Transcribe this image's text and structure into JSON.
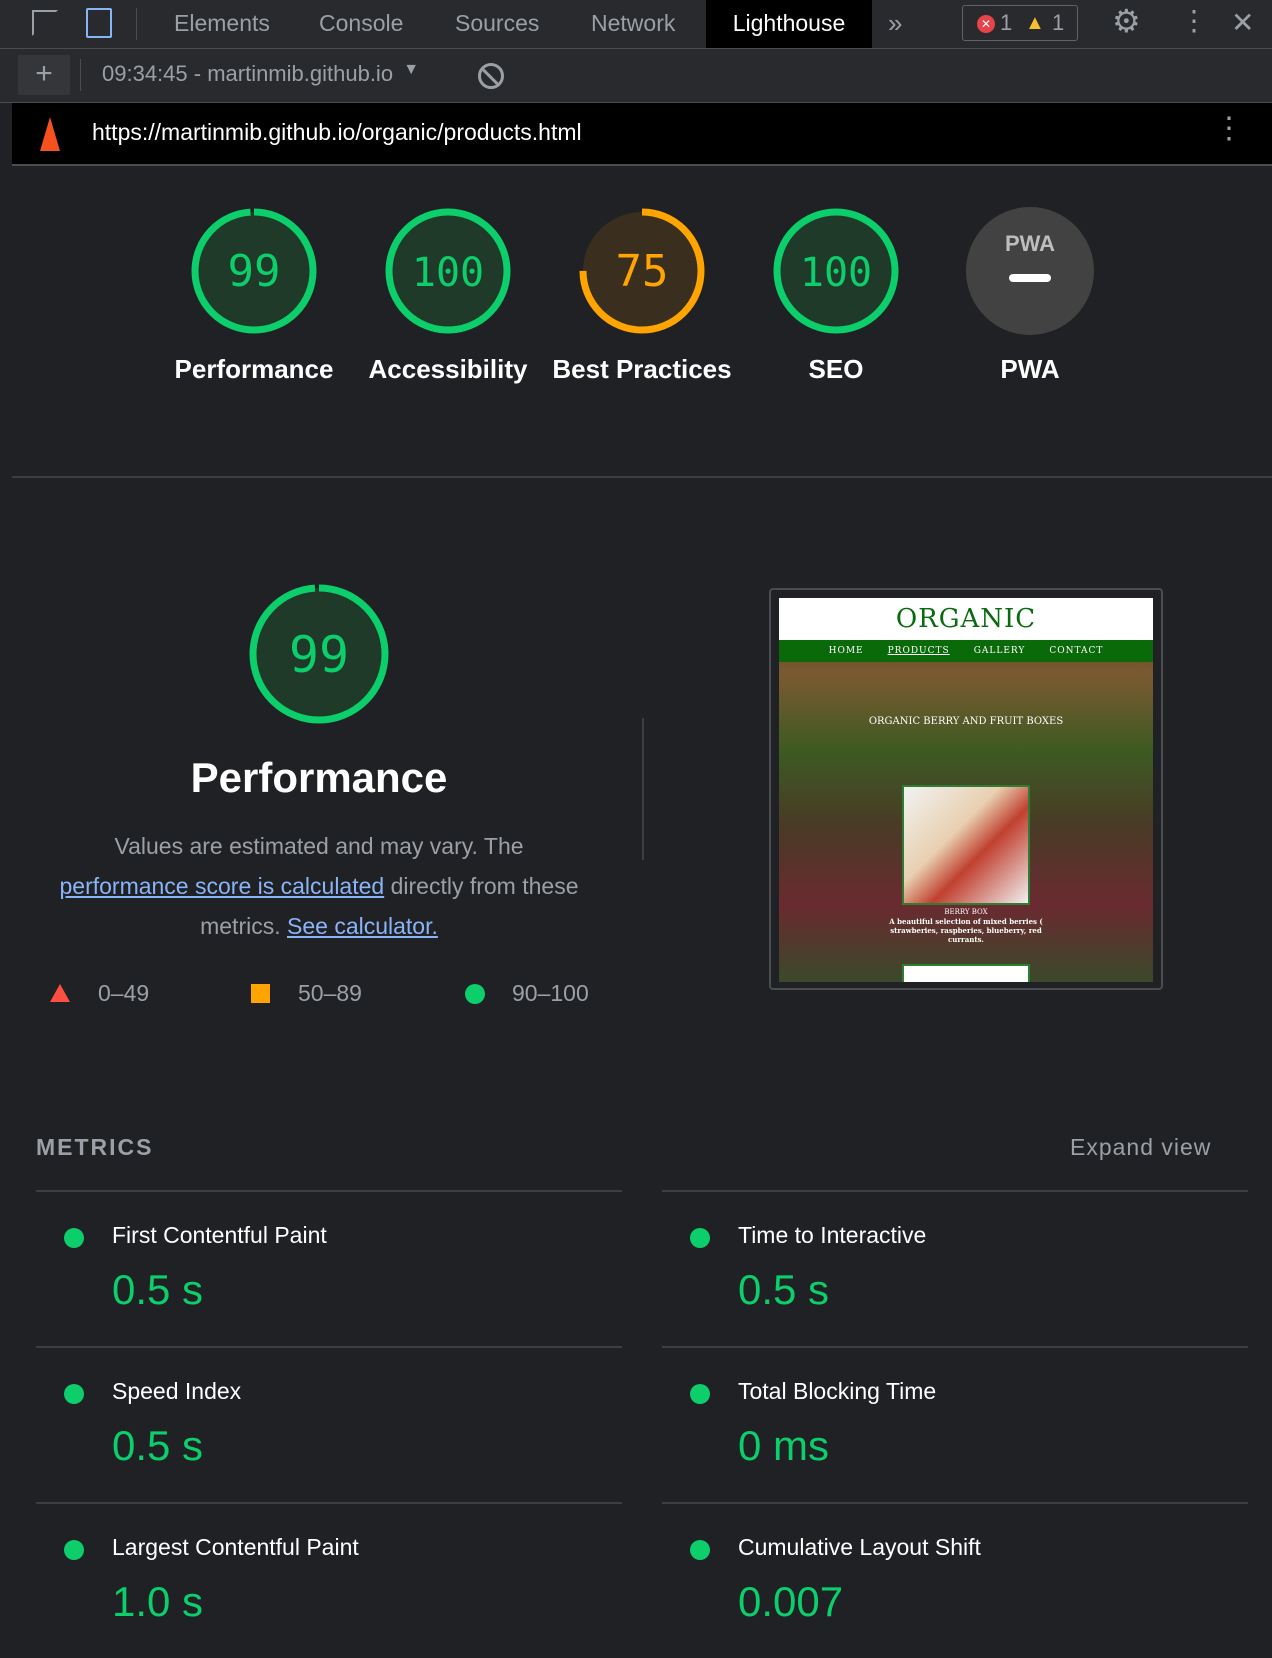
{
  "devtools": {
    "tabs": [
      "Elements",
      "Console",
      "Sources",
      "Network",
      "Lighthouse"
    ],
    "active_tab": "Lighthouse",
    "error_count": "1",
    "warning_count": "1"
  },
  "toolbar": {
    "report_select": "09:34:45 - martinmib.github.io"
  },
  "report": {
    "url": "https://martinmib.github.io/organic/products.html"
  },
  "gauges": [
    {
      "label": "Performance",
      "score": "99",
      "status": "pass"
    },
    {
      "label": "Accessibility",
      "score": "100",
      "status": "pass"
    },
    {
      "label": "Best Practices",
      "score": "75",
      "status": "average"
    },
    {
      "label": "SEO",
      "score": "100",
      "status": "pass"
    },
    {
      "label": "PWA",
      "score": "PWA",
      "status": "na"
    }
  ],
  "colors": {
    "pass": "#0cce6b",
    "average": "#ffa400",
    "fail": "#ff4e42"
  },
  "performance": {
    "score": "99",
    "title": "Performance",
    "desc_1": "Values are estimated and may vary. The",
    "link_1": "performance score is calculated",
    "desc_2": "directly from these",
    "desc_3": "metrics.",
    "link_2": "See calculator.",
    "legend": [
      {
        "range": "0–49",
        "icon": "triangle"
      },
      {
        "range": "50–89",
        "icon": "square"
      },
      {
        "range": "90–100",
        "icon": "circle"
      }
    ]
  },
  "thumbnail": {
    "site_title": "ORGANIC",
    "nav": [
      "HOME",
      "PRODUCTS",
      "GALLERY",
      "CONTACT"
    ],
    "hero": "ORGANIC BERRY AND FRUIT BOXES",
    "card_title": "BERRY BOX",
    "card_desc": "A beautiful selection of mixed berries ( strawberies, raspberies, blueberry, red currants."
  },
  "metrics": {
    "heading": "METRICS",
    "expand": "Expand view",
    "items": [
      {
        "label": "First Contentful Paint",
        "value": "0.5 s"
      },
      {
        "label": "Time to Interactive",
        "value": "0.5 s"
      },
      {
        "label": "Speed Index",
        "value": "0.5 s"
      },
      {
        "label": "Total Blocking Time",
        "value": "0 ms"
      },
      {
        "label": "Largest Contentful Paint",
        "value": "1.0 s"
      },
      {
        "label": "Cumulative Layout Shift",
        "value": "0.007"
      }
    ]
  }
}
